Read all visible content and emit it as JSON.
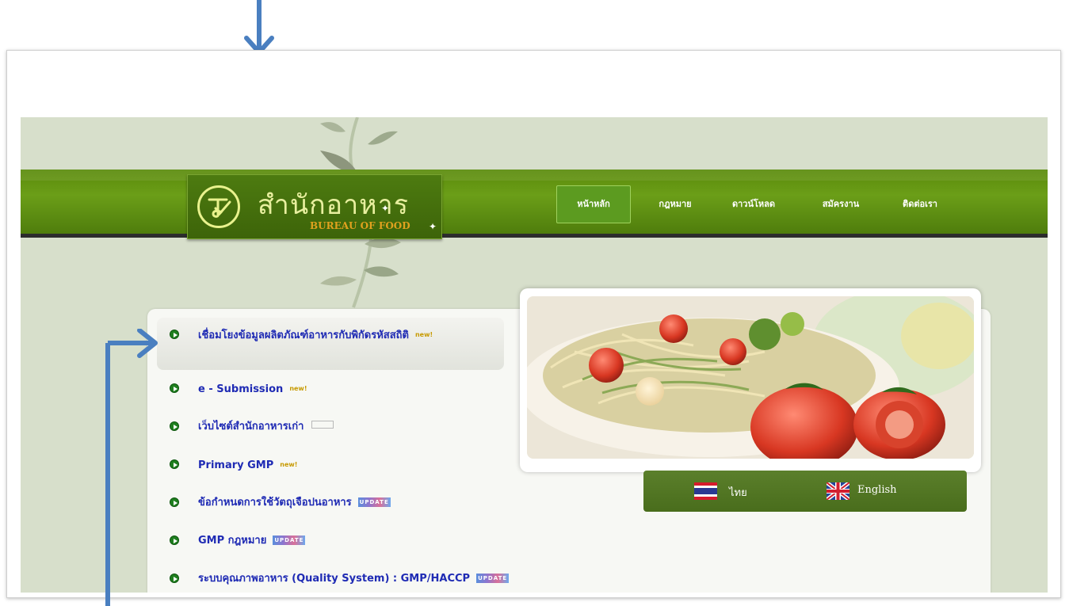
{
  "header": {
    "logo_title_th": "สำนักอาหาร",
    "logo_title_en": "BUREAU OF FOOD",
    "nav": [
      {
        "label": "หน้าหลัก",
        "active": true
      },
      {
        "label": "กฎหมาย",
        "active": false
      },
      {
        "label": "ดาวน์โหลด",
        "active": false
      },
      {
        "label": "สมัครงาน",
        "active": false
      },
      {
        "label": "ติดต่อเรา",
        "active": false
      }
    ]
  },
  "links": [
    {
      "label": "เชื่อมโยงข้อมูลผลิตภัณฑ์อาหารกับพิกัดรหัสสถิติ",
      "tag": "new!"
    },
    {
      "label": "e - Submission",
      "tag": "new!"
    },
    {
      "label": "เว็บไซต์สำนักอาหารเก่า",
      "tag": ""
    },
    {
      "label": "Primary GMP",
      "tag": "new!"
    },
    {
      "label": "ข้อกำหนดการใช้วัตถุเจือปนอาหาร",
      "tag": "UPDATE"
    },
    {
      "label": "GMP กฎหมาย",
      "tag": "UPDATE"
    },
    {
      "label": "ระบบคุณภาพอาหาร (Quality System) : GMP/HACCP",
      "tag": "UPDATE"
    }
  ],
  "languages": [
    {
      "label": "ไทย",
      "flag": "thai-flag"
    },
    {
      "label": "English",
      "flag": "uk-flag"
    }
  ],
  "colors": {
    "nav_green": "#5a8a0a",
    "link_blue": "#1f2bb4",
    "annotation_arrow": "#4a7fc0"
  }
}
